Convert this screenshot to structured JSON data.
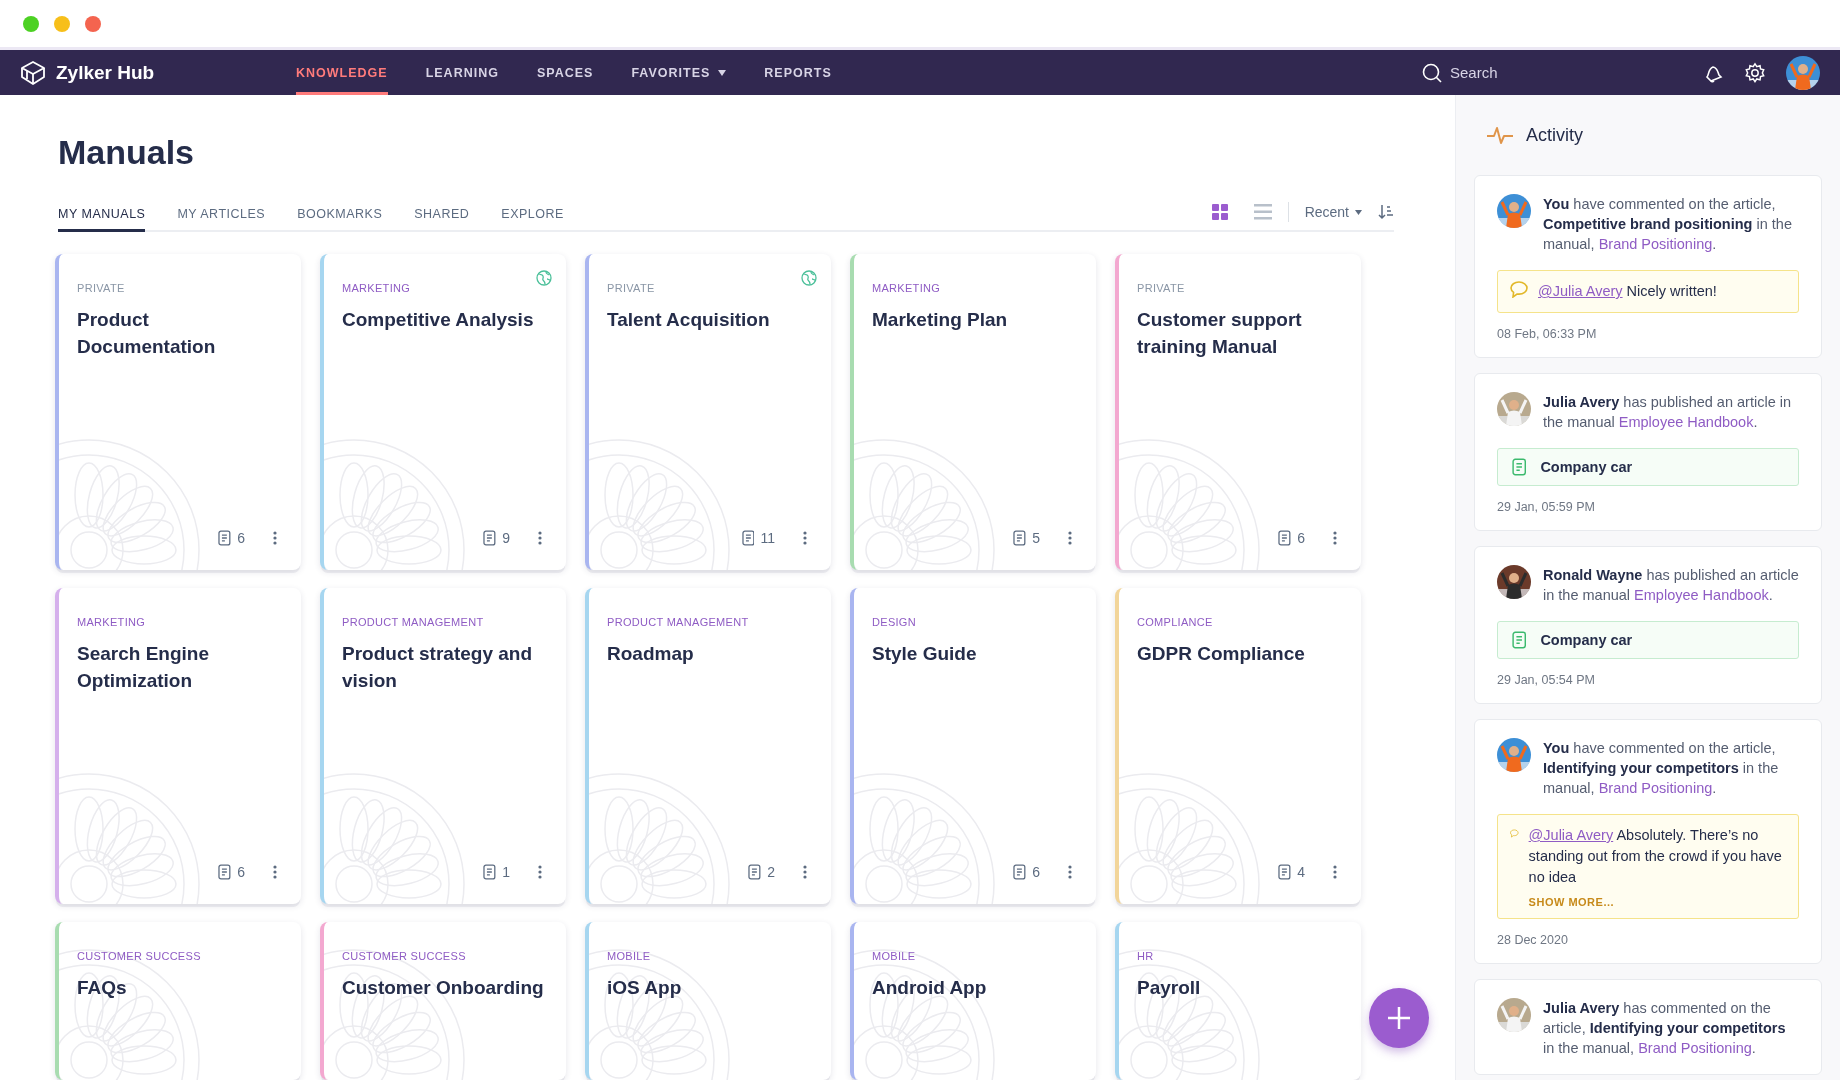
{
  "app": {
    "name": "Zylker Hub"
  },
  "nav": [
    {
      "label": "KNOWLEDGE",
      "selected": true,
      "has_menu": false
    },
    {
      "label": "LEARNING",
      "selected": false,
      "has_menu": false
    },
    {
      "label": "SPACES",
      "selected": false,
      "has_menu": false
    },
    {
      "label": "FAVORITES",
      "selected": false,
      "has_menu": true
    },
    {
      "label": "REPORTS",
      "selected": false,
      "has_menu": false
    }
  ],
  "search": {
    "placeholder": "Search"
  },
  "page_title": "Manuals",
  "tabs": [
    {
      "label": "MY MANUALS",
      "selected": true
    },
    {
      "label": "MY ARTICLES",
      "selected": false
    },
    {
      "label": "BOOKMARKS",
      "selected": false
    },
    {
      "label": "SHARED",
      "selected": false
    },
    {
      "label": "EXPLORE",
      "selected": false
    }
  ],
  "view_options": [
    {
      "kind": "grid",
      "selected": true
    },
    {
      "kind": "list",
      "selected": false
    }
  ],
  "sort": {
    "label": "Recent"
  },
  "manuals": [
    {
      "category": "PRIVATE",
      "private": true,
      "title": "Product Documentation",
      "shared": false,
      "count": "6",
      "color": "#a9b5f0"
    },
    {
      "category": "MARKETING",
      "private": false,
      "title": "Competitive Analysis",
      "shared": true,
      "count": "9",
      "color": "#a6d6f0"
    },
    {
      "category": "PRIVATE",
      "private": true,
      "title": "Talent Acquisition",
      "shared": true,
      "count": "11",
      "color": "#a9b5f0"
    },
    {
      "category": "MARKETING",
      "private": false,
      "title": "Marketing Plan",
      "shared": false,
      "count": "5",
      "color": "#a8dcb0"
    },
    {
      "category": "PRIVATE",
      "private": true,
      "title": "Customer support training Manual",
      "shared": false,
      "count": "6",
      "color": "#f3a8d0"
    },
    {
      "category": "MARKETING",
      "private": false,
      "title": "Search Engine Optimization",
      "shared": false,
      "count": "6",
      "color": "#d5b0ec"
    },
    {
      "category": "PRODUCT MANAGEMENT",
      "private": false,
      "title": "Product strategy and vision",
      "shared": false,
      "count": "1",
      "color": "#a6d6f0"
    },
    {
      "category": "PRODUCT MANAGEMENT",
      "private": false,
      "title": "Roadmap",
      "shared": false,
      "count": "2",
      "color": "#a6d6f0"
    },
    {
      "category": "DESIGN",
      "private": false,
      "title": "Style Guide",
      "shared": false,
      "count": "6",
      "color": "#a9b5f0"
    },
    {
      "category": "COMPLIANCE",
      "private": false,
      "title": "GDPR Compliance",
      "shared": false,
      "count": "4",
      "color": "#f2d59a"
    },
    {
      "category": "CUSTOMER SUCCESS",
      "private": false,
      "title": "FAQs",
      "shared": false,
      "color": "#a8dcb0"
    },
    {
      "category": "CUSTOMER SUCCESS",
      "private": false,
      "title": "Customer Onboarding",
      "shared": false,
      "color": "#f3a8d0"
    },
    {
      "category": "MOBILE",
      "private": false,
      "title": "iOS App",
      "shared": false,
      "color": "#a6d6f0"
    },
    {
      "category": "MOBILE",
      "private": false,
      "title": "Android App",
      "shared": false,
      "color": "#a9b5f0"
    },
    {
      "category": "HR",
      "private": false,
      "title": "Payroll",
      "shared": false,
      "color": "#a6d6f0"
    }
  ],
  "activity": {
    "title": "Activity",
    "items": [
      {
        "message": "**You** have commented on the article, **Competitive brand positioning** in the manual,",
        "link": "Brand Positioning",
        "after": ".",
        "attachment": {
          "kind": "comment",
          "mention": "@Julia Avery",
          "text": "Nicely written!"
        },
        "time": "08 Feb, 06:33 PM"
      },
      {
        "message": "**Julia Avery** has published an article in the manual",
        "link": "Employee Handbook",
        "after": ".",
        "attachment": {
          "kind": "article",
          "text": "Company car"
        },
        "time": "29 Jan, 05:59 PM"
      },
      {
        "message": "**Ronald Wayne** has published an article in the manual",
        "link": "Employee Handbook",
        "after": ".",
        "attachment": {
          "kind": "article",
          "text": "Company car"
        },
        "time": "29 Jan, 05:54 PM"
      },
      {
        "message": "**You** have commented on the article, **Identifying your competitors** in the manual,",
        "link": "Brand Positioning",
        "after": ".",
        "attachment": {
          "kind": "comment",
          "mention": "@Julia Avery",
          "text": "Absolutely. There’s no standing out from the crowd if you have no idea",
          "more": "SHOW MORE..."
        },
        "time": "28 Dec 2020"
      },
      {
        "message": "**Julia Avery** has commented on the article, **Identifying your competitors** in the manual,",
        "link": "Brand Positioning",
        "after": "."
      }
    ]
  }
}
